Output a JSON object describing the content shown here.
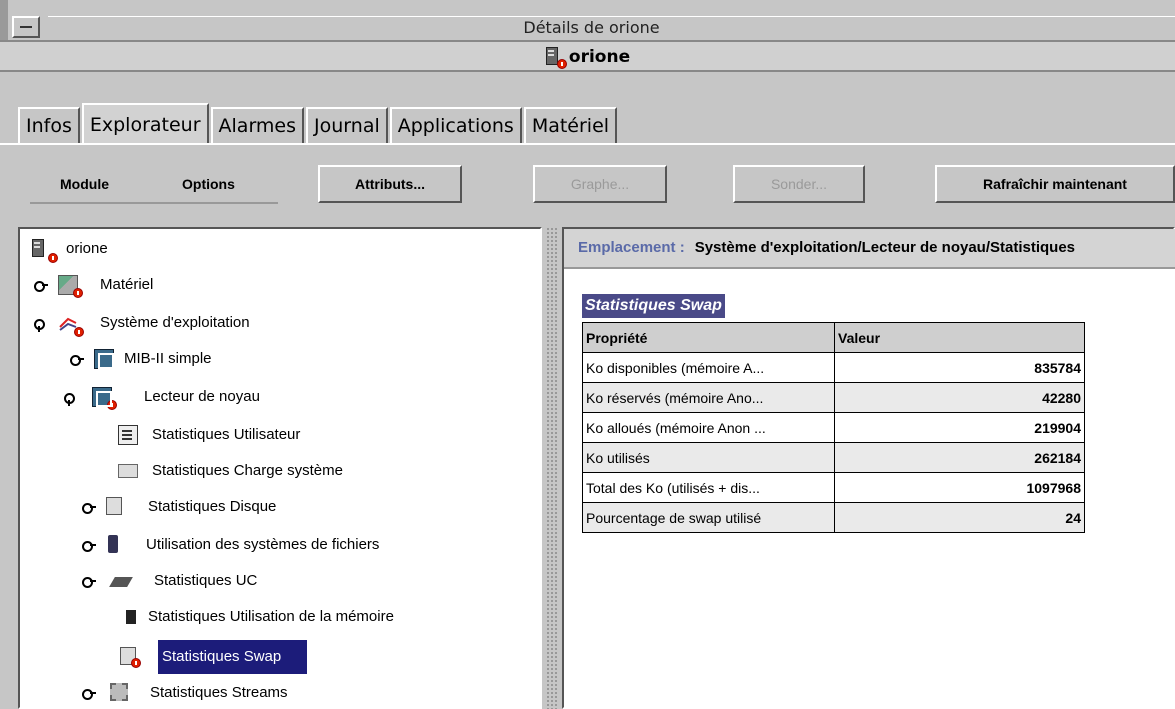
{
  "window": {
    "title": "Détails de orione",
    "host_name": "orione"
  },
  "tabs": [
    {
      "label": "Infos"
    },
    {
      "label": "Explorateur",
      "active": true
    },
    {
      "label": "Alarmes"
    },
    {
      "label": "Journal"
    },
    {
      "label": "Applications"
    },
    {
      "label": "Matériel"
    }
  ],
  "toolbar": {
    "module_label": "Module",
    "options_label": "Options",
    "attributes_label": "Attributs...",
    "graph_label": "Graphe...",
    "probe_label": "Sonder...",
    "refresh_label": "Rafraîchir maintenant"
  },
  "tree": {
    "root": "orione",
    "items": [
      {
        "label": "Matériel"
      },
      {
        "label": "Système d'exploitation"
      },
      {
        "label": "MIB-II simple"
      },
      {
        "label": "Lecteur de noyau"
      },
      {
        "label": "Statistiques Utilisateur"
      },
      {
        "label": "Statistiques Charge système"
      },
      {
        "label": "Statistiques Disque"
      },
      {
        "label": "Utilisation des systèmes de fichiers"
      },
      {
        "label": "Statistiques UC"
      },
      {
        "label": "Statistiques Utilisation de la mémoire"
      },
      {
        "label": "Statistiques Swap",
        "selected": true
      },
      {
        "label": "Statistiques Streams"
      }
    ]
  },
  "location": {
    "label": "Emplacement :",
    "value": "Système d'exploitation/Lecteur de noyau/Statistiques"
  },
  "swap": {
    "title": "Statistiques Swap",
    "headers": {
      "property": "Propriété",
      "value": "Valeur"
    },
    "rows": [
      {
        "property": "Ko disponibles (mémoire A...",
        "value": "835784"
      },
      {
        "property": "Ko réservés (mémoire Ano...",
        "value": "42280"
      },
      {
        "property": "Ko alloués (mémoire Anon ...",
        "value": "219904"
      },
      {
        "property": "Ko utilisés",
        "value": "262184",
        "status": "critical"
      },
      {
        "property": "Total des Ko (utilisés + dis...",
        "value": "1097968"
      },
      {
        "property": "Pourcentage de swap utilisé",
        "value": "24"
      }
    ]
  },
  "colors": {
    "selection": "#1c1c7a",
    "critical": "#f00000",
    "location_label": "#5a6aa8"
  }
}
